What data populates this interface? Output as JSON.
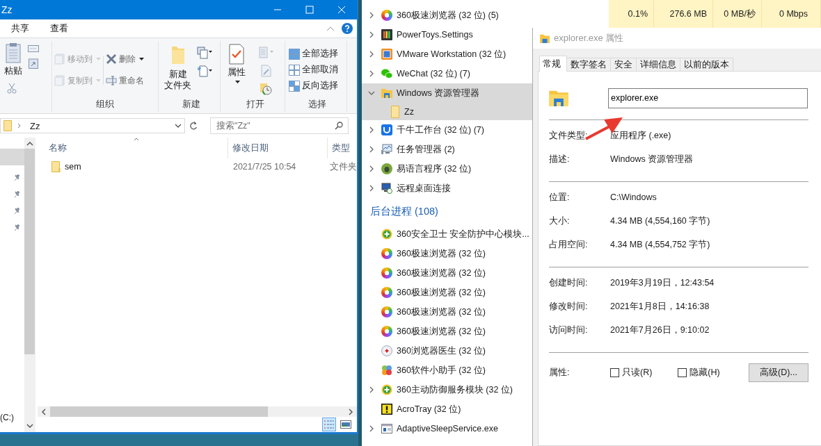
{
  "explorer": {
    "title": "Zz",
    "ribbon_tabs": [
      {
        "label": "共享",
        "selected": false
      },
      {
        "label": "查看",
        "selected": false
      }
    ],
    "clipboard": {
      "paste": "粘贴"
    },
    "organize": {
      "label": "组织",
      "buttons": [
        {
          "label": "移动到",
          "disabled": true
        },
        {
          "label": "复制到",
          "disabled": true
        },
        {
          "label": "删除",
          "disabled": false
        },
        {
          "label": "重命名",
          "disabled": false
        }
      ]
    },
    "new": {
      "label": "新建",
      "new_folder": [
        "新建",
        "文件夹"
      ]
    },
    "open": {
      "label": "打开",
      "properties": "属性"
    },
    "select": {
      "label": "选择",
      "buttons": [
        "全部选择",
        "全部取消",
        "反向选择"
      ]
    },
    "address": {
      "path": "Zz"
    },
    "search": {
      "placeholder": "搜索\"Zz\""
    },
    "nav": {
      "drive": "(C:)"
    },
    "columns": [
      "名称",
      "修改日期",
      "类型"
    ],
    "rows": [
      {
        "name": "sem",
        "modified": "2021/7/25 10:54",
        "type": "文件夹"
      }
    ],
    "view_modes": [
      {
        "kind": "details",
        "selected": true
      },
      {
        "kind": "large-icons",
        "selected": false
      }
    ]
  },
  "task_manager": {
    "metrics": [
      "0.1%",
      "276.6 MB",
      "0 MB/秒",
      "0 Mbps"
    ],
    "processes": [
      {
        "label": "360极速浏览器 (32 位) (5)",
        "kind": "group",
        "expanded": false,
        "selected": false
      },
      {
        "label": "PowerToys.Settings",
        "kind": "group",
        "expanded": false,
        "selected": false
      },
      {
        "label": "VMware Workstation (32 位)",
        "kind": "group",
        "expanded": false,
        "selected": false
      },
      {
        "label": "WeChat (32 位) (7)",
        "kind": "group",
        "expanded": false,
        "selected": false
      },
      {
        "label": "Windows 资源管理器",
        "kind": "group",
        "expanded": true,
        "selected": true
      },
      {
        "label": "Zz",
        "kind": "child",
        "selected": true
      },
      {
        "label": "千牛工作台 (32 位) (7)",
        "kind": "group",
        "expanded": false,
        "selected": false
      },
      {
        "label": "任务管理器 (2)",
        "kind": "group",
        "expanded": false,
        "selected": false
      },
      {
        "label": "易语言程序 (32 位)",
        "kind": "group",
        "expanded": false,
        "selected": false
      },
      {
        "label": "远程桌面连接",
        "kind": "group",
        "expanded": false,
        "selected": false
      },
      {
        "label": "后台进程 (108)",
        "kind": "header",
        "selected": false
      },
      {
        "label": "360安全卫士 安全防护中心模块...",
        "kind": "single",
        "selected": false
      },
      {
        "label": "360极速浏览器 (32 位)",
        "kind": "single",
        "selected": false
      },
      {
        "label": "360极速浏览器 (32 位)",
        "kind": "single",
        "selected": false
      },
      {
        "label": "360极速浏览器 (32 位)",
        "kind": "single",
        "selected": false
      },
      {
        "label": "360极速浏览器 (32 位)",
        "kind": "single",
        "selected": false
      },
      {
        "label": "360极速浏览器 (32 位)",
        "kind": "single",
        "selected": false
      },
      {
        "label": "360浏览器医生 (32 位)",
        "kind": "single",
        "selected": false
      },
      {
        "label": "360软件小助手 (32 位)",
        "kind": "single",
        "selected": false
      },
      {
        "label": "360主动防御服务模块 (32 位)",
        "kind": "group",
        "expanded": false,
        "selected": false
      },
      {
        "label": "AcroTray (32 位)",
        "kind": "single",
        "selected": false
      },
      {
        "label": "AdaptiveSleepService.exe",
        "kind": "group",
        "expanded": false,
        "selected": false
      }
    ]
  },
  "properties": {
    "title": "explorer.exe 属性",
    "tabs": [
      {
        "label": "常规",
        "selected": true
      },
      {
        "label": "数字签名",
        "selected": false
      },
      {
        "label": "安全",
        "selected": false
      },
      {
        "label": "详细信息",
        "selected": false
      },
      {
        "label": "以前的版本",
        "selected": false
      }
    ],
    "name": "explorer.exe",
    "sections": [
      [
        {
          "label": "文件类型:",
          "value": "应用程序 (.exe)"
        },
        {
          "label": "描述:",
          "value": "Windows 资源管理器"
        }
      ],
      [
        {
          "label": "位置:",
          "value": "C:\\Windows"
        },
        {
          "label": "大小:",
          "value": "4.34 MB (4,554,160 字节)"
        },
        {
          "label": "占用空间:",
          "value": "4.34 MB (4,554,752 字节)"
        }
      ],
      [
        {
          "label": "创建时间:",
          "value": "2019年3月19日，12:43:54"
        },
        {
          "label": "修改时间:",
          "value": "2021年1月8日，14:16:38"
        },
        {
          "label": "访问时间:",
          "value": "2021年7月26日，9:10:02"
        }
      ]
    ],
    "attributes": {
      "label": "属性:",
      "checkboxes": [
        {
          "label": "只读(R)",
          "checked": false
        },
        {
          "label": "隐藏(H)",
          "checked": false
        }
      ],
      "advanced": "高级(D)..."
    }
  }
}
